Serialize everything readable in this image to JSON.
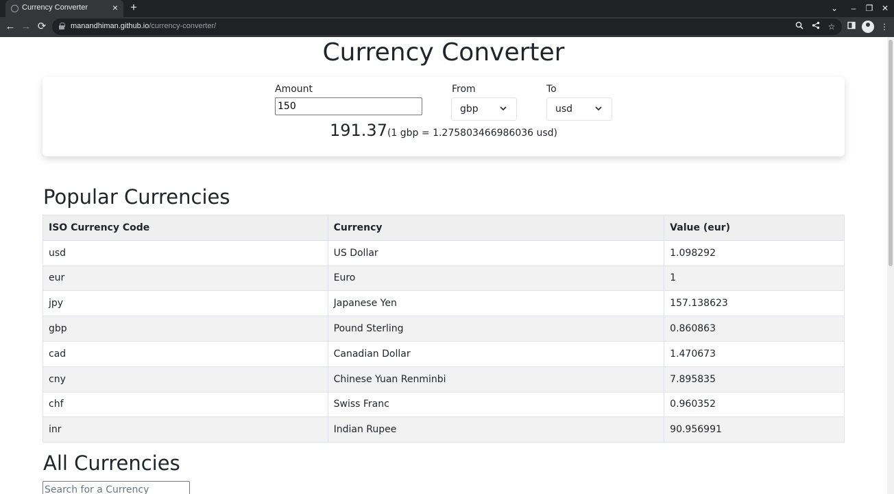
{
  "browser": {
    "tab_title": "Currency Converter",
    "tab_close": "×",
    "new_tab": "+",
    "url_host": "manandhiman.github.io",
    "url_path": "/currency-converter/",
    "back": "←",
    "forward": "→",
    "reload": "⟳",
    "tab_search": "⌄",
    "minimize": "–",
    "restore": "❐",
    "close": "✕",
    "zoom_icon": "🔍",
    "share_icon": "⇧",
    "star_icon": "☆",
    "side_panel_icon": "▯",
    "menu_icon": "⋮"
  },
  "page": {
    "title": "Currency Converter",
    "converter": {
      "amount_label": "Amount",
      "amount_value": "150",
      "from_label": "From",
      "from_value": "gbp",
      "to_label": "To",
      "to_value": "usd",
      "result_value": "191.37",
      "result_rate": "(1 gbp = 1.275803466986036 usd)"
    },
    "popular": {
      "heading": "Popular Currencies",
      "headers": [
        "ISO Currency Code",
        "Currency",
        "Value (eur)"
      ],
      "rows": [
        [
          "usd",
          "US Dollar",
          "1.098292"
        ],
        [
          "eur",
          "Euro",
          "1"
        ],
        [
          "jpy",
          "Japanese Yen",
          "157.138623"
        ],
        [
          "gbp",
          "Pound Sterling",
          "0.860863"
        ],
        [
          "cad",
          "Canadian Dollar",
          "1.470673"
        ],
        [
          "cny",
          "Chinese Yuan Renminbi",
          "7.895835"
        ],
        [
          "chf",
          "Swiss Franc",
          "0.960352"
        ],
        [
          "inr",
          "Indian Rupee",
          "90.956991"
        ]
      ]
    },
    "all": {
      "heading": "All Currencies",
      "search_placeholder": "Search for a Currency"
    }
  }
}
